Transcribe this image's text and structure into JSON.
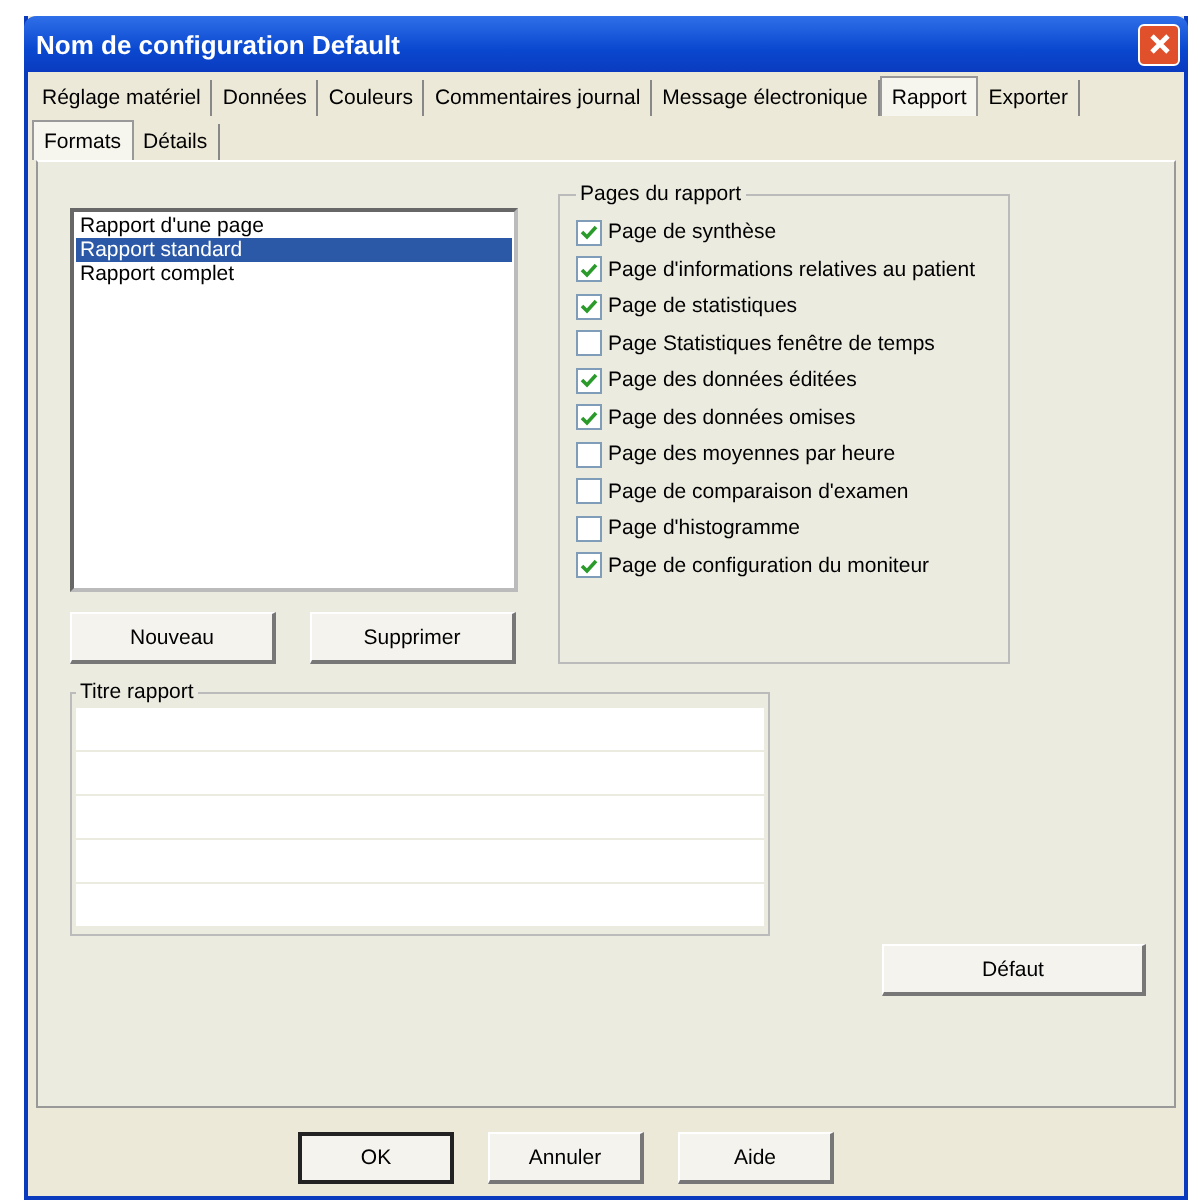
{
  "window": {
    "title": "Nom de configuration Default"
  },
  "tabs": [
    {
      "label": "Réglage matériel",
      "selected": false
    },
    {
      "label": "Données",
      "selected": false
    },
    {
      "label": "Couleurs",
      "selected": false
    },
    {
      "label": "Commentaires journal",
      "selected": false
    },
    {
      "label": "Message électronique",
      "selected": false
    },
    {
      "label": "Rapport",
      "selected": true
    },
    {
      "label": "Exporter",
      "selected": false
    }
  ],
  "subtabs": [
    {
      "label": "Formats",
      "selected": true
    },
    {
      "label": "Détails",
      "selected": false
    }
  ],
  "report_list": [
    {
      "label": "Rapport d'une page",
      "selected": false
    },
    {
      "label": "Rapport standard",
      "selected": true
    },
    {
      "label": "Rapport complet",
      "selected": false
    }
  ],
  "list_buttons": [
    "Nouveau",
    "Supprimer"
  ],
  "pages_group": {
    "title": "Pages du rapport",
    "items": [
      {
        "label": "Page de synthèse",
        "checked": true
      },
      {
        "label": "Page d'informations relatives au patient",
        "checked": true
      },
      {
        "label": "Page de statistiques",
        "checked": true
      },
      {
        "label": "Page Statistiques fenêtre de temps",
        "checked": false
      },
      {
        "label": "Page des données éditées",
        "checked": true
      },
      {
        "label": "Page des données omises",
        "checked": true
      },
      {
        "label": "Page des moyennes par heure",
        "checked": false
      },
      {
        "label": "Page de comparaison d'examen",
        "checked": false
      },
      {
        "label": "Page d'histogramme",
        "checked": false
      },
      {
        "label": "Page de configuration du moniteur",
        "checked": true
      }
    ]
  },
  "title_group": {
    "title": "Titre rapport"
  },
  "default_button": "Défaut",
  "buttons": [
    "OK",
    "Annuler",
    "Aide"
  ]
}
